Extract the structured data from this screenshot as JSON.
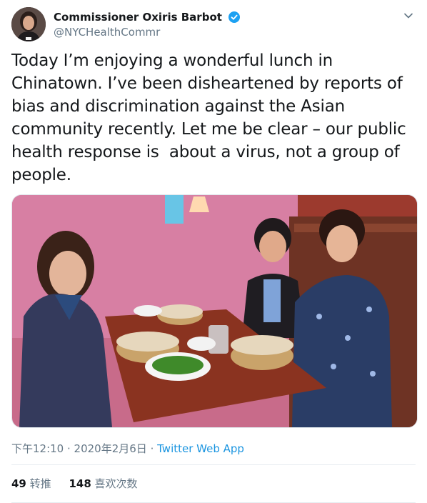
{
  "author": {
    "display_name": "Commissioner Oxiris Barbot",
    "handle": "@NYCHealthCommr",
    "verified_icon": "verified-badge-icon",
    "avatar_icon": "profile-avatar"
  },
  "tweet": {
    "text": "Today I’m enjoying a wonderful lunch in\nChinatown. I’ve been disheartened by reports of\nbias and discrimination against the Asian\ncommunity recently. Let me be clear – our public\nhealth response is  about a virus, not a group of\npeople."
  },
  "meta": {
    "time": "下午12:10",
    "separator": " · ",
    "date": "2020年2月6日",
    "source": "Twitter Web App"
  },
  "stats": {
    "retweets_count": "49",
    "retweets_label": "转推",
    "likes_count": "148",
    "likes_label": "喜欢次数"
  },
  "colors": {
    "accent": "#1da1f2",
    "link": "#1b95e0",
    "secondary_text": "#657786"
  }
}
